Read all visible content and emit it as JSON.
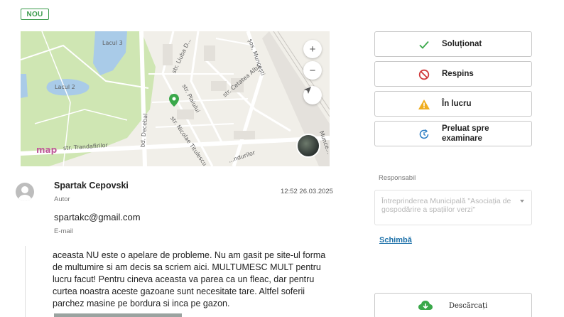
{
  "status_badge": "NOU",
  "map": {
    "labels": {
      "lake3": "Lacul 3",
      "lake2": "Lacul 2",
      "str_liuba": "str. Liuba D...",
      "sos_muncesti": "șos. Muncești",
      "str_cetatea_alba": "str. Cetatea Albă",
      "str_plaiului": "str. Plaiului",
      "bd_decebal": "bd. Decebal",
      "str_nicolae": "str. Nicolae Titulescu",
      "str_trandafirilor": "str. Trandafirilor",
      "str_dendurilor": "...ndurilor",
      "muncesti_2": "Munce..."
    },
    "zoom_in": "+",
    "zoom_out": "−",
    "logo": "map",
    "colors": {
      "park": "#c8e3a9",
      "water": "#a9cbe8",
      "road": "#ffffff",
      "marker": "#3aa84a"
    }
  },
  "author": {
    "name": "Spartak Cepovski",
    "role": "Autor",
    "timestamp": "12:52 26.03.2025",
    "email": "spartakc@gmail.com",
    "email_label": "E-mail"
  },
  "message": "aceasta NU este o apelare de probleme. Nu am gasit pe site-ul forma de multumire si am decis sa scriem aici. MULTUMESC MULT pentru lucru facut! Pentru cineva aceasta va parea ca un fleac, dar pentru curtea noastra aceste gazoane sunt necesitate tare. Altfel soferii parchez masine pe bordura si inca pe gazon.",
  "actions": [
    {
      "label": "Soluționat",
      "icon": "check-icon",
      "color": "#3aa84a"
    },
    {
      "label": "Respins",
      "icon": "ban-icon",
      "color": "#d0393b"
    },
    {
      "label": "În lucru",
      "icon": "warning-icon",
      "color": "#f0ad1e"
    },
    {
      "label": "Preluat spre examinare",
      "icon": "refresh-clock-icon",
      "color": "#2f7fc4"
    }
  ],
  "responsible": {
    "label": "Responsabil",
    "value": "Întreprinderea Municipală \"Asociația de gospodărire a spațiilor verzi\"",
    "change_link": "Schimbă"
  },
  "download_label": "Descărcați"
}
